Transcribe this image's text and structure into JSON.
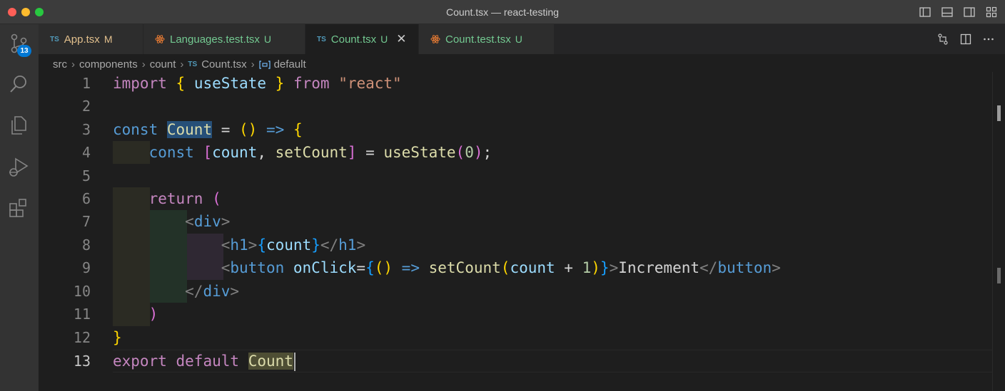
{
  "window": {
    "title": "Count.tsx — react-testing"
  },
  "activity": {
    "badge": "13"
  },
  "tabs": [
    {
      "icon": "TS",
      "name": "App.tsx",
      "status": "M"
    },
    {
      "icon": "react",
      "name": "Languages.test.tsx",
      "status": "U"
    },
    {
      "icon": "TS",
      "name": "Count.tsx",
      "status": "U",
      "close": "✕"
    },
    {
      "icon": "react",
      "name": "Count.test.tsx",
      "status": "U"
    }
  ],
  "breadcrumb": {
    "items": [
      "src",
      "components",
      "count"
    ],
    "file_icon": "TS",
    "file": "Count.tsx",
    "symbol": "default",
    "sep": "›"
  },
  "editor": {
    "line_numbers": [
      "1",
      "2",
      "3",
      "4",
      "5",
      "6",
      "7",
      "8",
      "9",
      "10",
      "11",
      "12",
      "13"
    ],
    "current_line": "13"
  },
  "colors": {
    "keyword_control": "#c586c0",
    "keyword": "#569cd6",
    "function": "#dcdcaa",
    "variable": "#9cdcfe",
    "string": "#ce9178",
    "number": "#b5cea8",
    "modified": "#e2c08d",
    "untracked": "#73c991",
    "accent": "#0078d4"
  },
  "icons": {
    "activity": [
      "source-control-icon",
      "search-icon",
      "explorer-icon",
      "run-debug-icon",
      "extensions-icon"
    ],
    "title": [
      "toggle-primary-sidebar-icon",
      "toggle-panel-icon",
      "toggle-secondary-sidebar-icon",
      "customize-layout-icon"
    ],
    "editor_actions": [
      "open-changes-icon",
      "split-editor-icon",
      "more-actions-icon"
    ]
  }
}
